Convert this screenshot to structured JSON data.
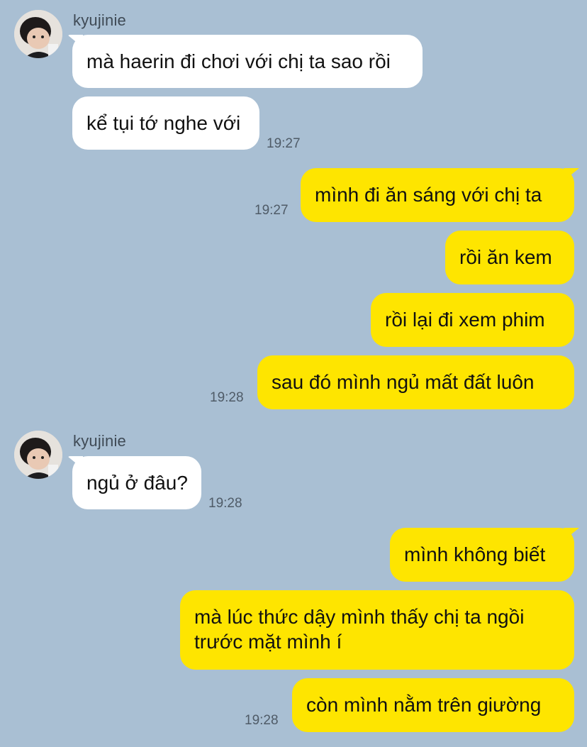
{
  "chat": {
    "sender_name": "kyujinie",
    "messages": [
      {
        "text": "mà haerin đi chơi với chị ta sao rồi"
      },
      {
        "text": "kể tụi tớ nghe với",
        "time": "19:27"
      },
      {
        "text": "mình đi ăn sáng với chị ta",
        "time": "19:27"
      },
      {
        "text": "rồi ăn kem"
      },
      {
        "text": "rồi lại đi xem phim"
      },
      {
        "text": "sau đó mình ngủ mất đất luôn",
        "time": "19:28"
      },
      {
        "text": "ngủ ở đâu?",
        "time": "19:28"
      },
      {
        "text": "mình không biết"
      },
      {
        "text": "mà lúc thức dậy mình thấy chị ta ngồi trước mặt mình í"
      },
      {
        "text": "còn mình nằm trên giường",
        "time": "19:28"
      }
    ]
  },
  "colors": {
    "background": "#a9bfd3",
    "incoming_bubble": "#ffffff",
    "outgoing_bubble": "#fee500",
    "text": "#111111",
    "timestamp": "#4f5b67"
  }
}
